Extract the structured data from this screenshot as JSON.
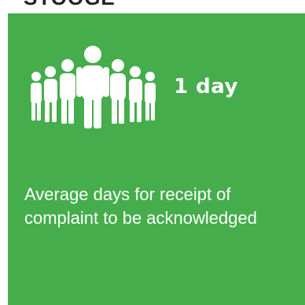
{
  "header": {
    "partial_title": "STOOGE"
  },
  "card": {
    "background_color": "#45ad4b",
    "icon": "people-group-icon",
    "metric": "1 day",
    "description": "Average days for receipt of complaint to be acknowledged"
  }
}
